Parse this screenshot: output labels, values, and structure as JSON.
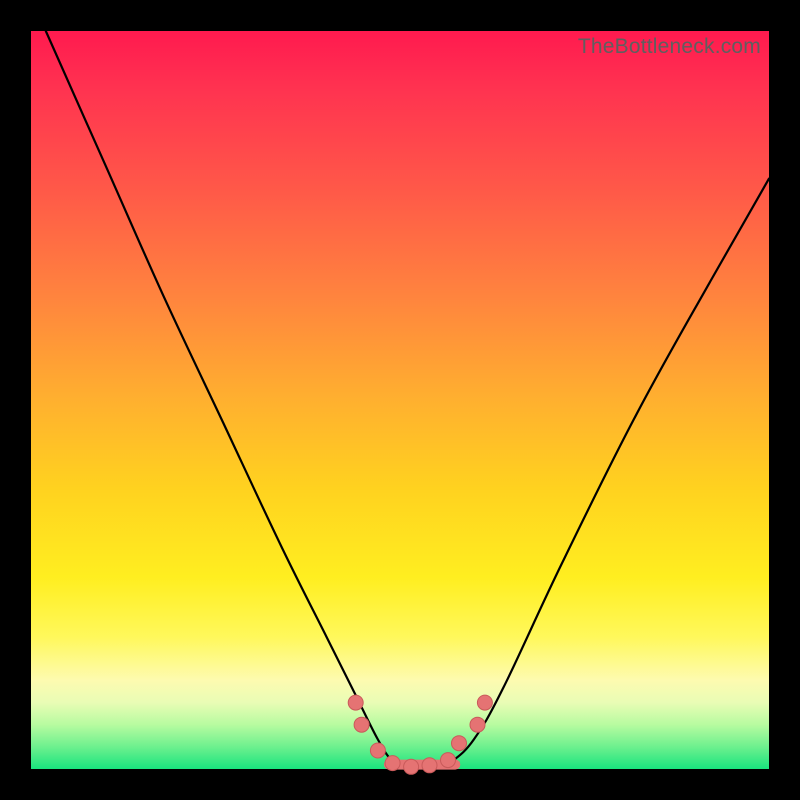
{
  "watermark": "TheBottleneck.com",
  "colors": {
    "gradient_top": "#ff1a4f",
    "gradient_mid_orange": "#ff843e",
    "gradient_mid_yellow": "#ffee20",
    "gradient_bottom": "#19e47e",
    "curve": "#000000",
    "markers": "#e57373",
    "frame": "#000000"
  },
  "chart_data": {
    "type": "line",
    "title": "",
    "xlabel": "",
    "ylabel": "",
    "xlim": [
      0,
      100
    ],
    "ylim": [
      0,
      100
    ],
    "grid": false,
    "series": [
      {
        "name": "bottleneck-curve",
        "x": [
          2,
          10,
          18,
          26,
          34,
          40,
          44,
          47,
          49,
          51,
          53,
          55,
          57,
          60,
          64,
          72,
          82,
          92,
          100
        ],
        "y": [
          100,
          82,
          64,
          47,
          30,
          18,
          10,
          4,
          1,
          0,
          0,
          0,
          1,
          4,
          11,
          28,
          48,
          66,
          80
        ]
      }
    ],
    "markers": [
      {
        "x": 44.0,
        "y": 9.0
      },
      {
        "x": 44.8,
        "y": 6.0
      },
      {
        "x": 47.0,
        "y": 2.5
      },
      {
        "x": 49.0,
        "y": 0.8
      },
      {
        "x": 51.5,
        "y": 0.3
      },
      {
        "x": 54.0,
        "y": 0.5
      },
      {
        "x": 56.5,
        "y": 1.2
      },
      {
        "x": 58.0,
        "y": 3.5
      },
      {
        "x": 60.5,
        "y": 6.0
      },
      {
        "x": 61.5,
        "y": 9.0
      }
    ],
    "flat_segment": {
      "x0": 48.5,
      "x1": 57.5,
      "y": 0.6
    },
    "annotations": []
  }
}
